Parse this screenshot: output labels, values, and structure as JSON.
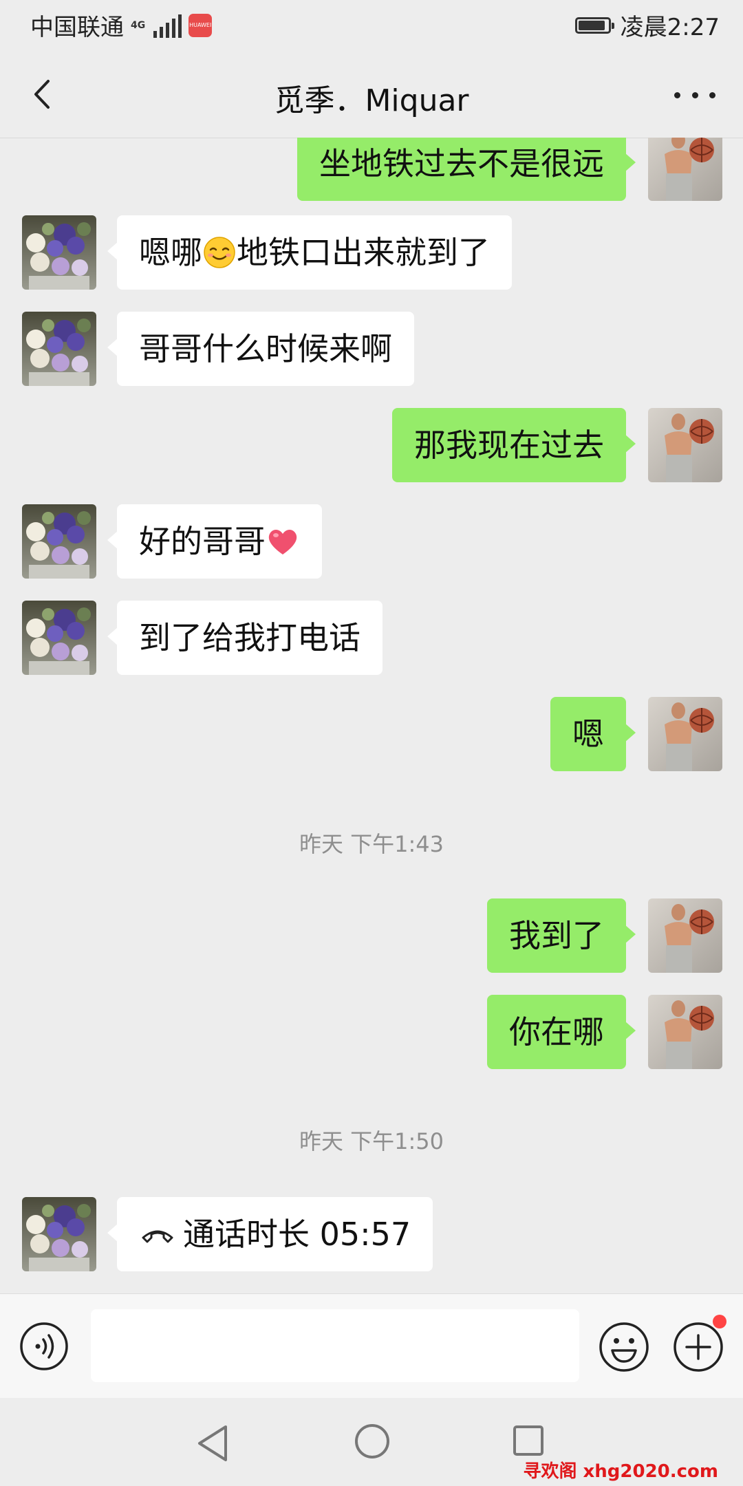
{
  "status_bar": {
    "carrier": "中国联通",
    "network": "4G",
    "time": "凌晨2:27",
    "battery_level_percent": 90
  },
  "header": {
    "back_icon": "chevron-left-icon",
    "title": "觅季．Miquar",
    "more_icon": "more-dots-icon"
  },
  "messages": [
    {
      "side": "out",
      "text": "坐地铁过去不是很远"
    },
    {
      "side": "in",
      "text_before": "嗯哪",
      "emoji": "smiling-face-emoji",
      "text_after": "地铁口出来就到了"
    },
    {
      "side": "in",
      "text": "哥哥什么时候来啊"
    },
    {
      "side": "out",
      "text": "那我现在过去"
    },
    {
      "side": "in",
      "text_before": "好的哥哥",
      "emoji": "heart-emoji"
    },
    {
      "side": "in",
      "text": "到了给我打电话"
    },
    {
      "side": "out",
      "text": "嗯"
    },
    {
      "timestamp": "昨天 下午1:43"
    },
    {
      "side": "out",
      "text": "我到了"
    },
    {
      "side": "out",
      "text": "你在哪"
    },
    {
      "timestamp": "昨天 下午1:50"
    },
    {
      "side": "in",
      "call_icon": "phone-hangup-icon",
      "text": "通话时长 05:57"
    }
  ],
  "input_bar": {
    "voice_icon": "voice-input-icon",
    "emoji_icon": "emoji-icon",
    "plus_icon": "plus-icon"
  },
  "nav_bar": {
    "back_icon": "nav-back-triangle-icon",
    "home_icon": "nav-home-circle-icon",
    "recent_icon": "nav-recent-square-icon"
  },
  "watermark": "寻欢阁 xhg2020.com",
  "colors": {
    "background": "#ededed",
    "sent_bubble": "#95ec69",
    "received_bubble": "#ffffff",
    "timestamp_text": "#8e8e8e",
    "watermark": "#e0181b"
  }
}
